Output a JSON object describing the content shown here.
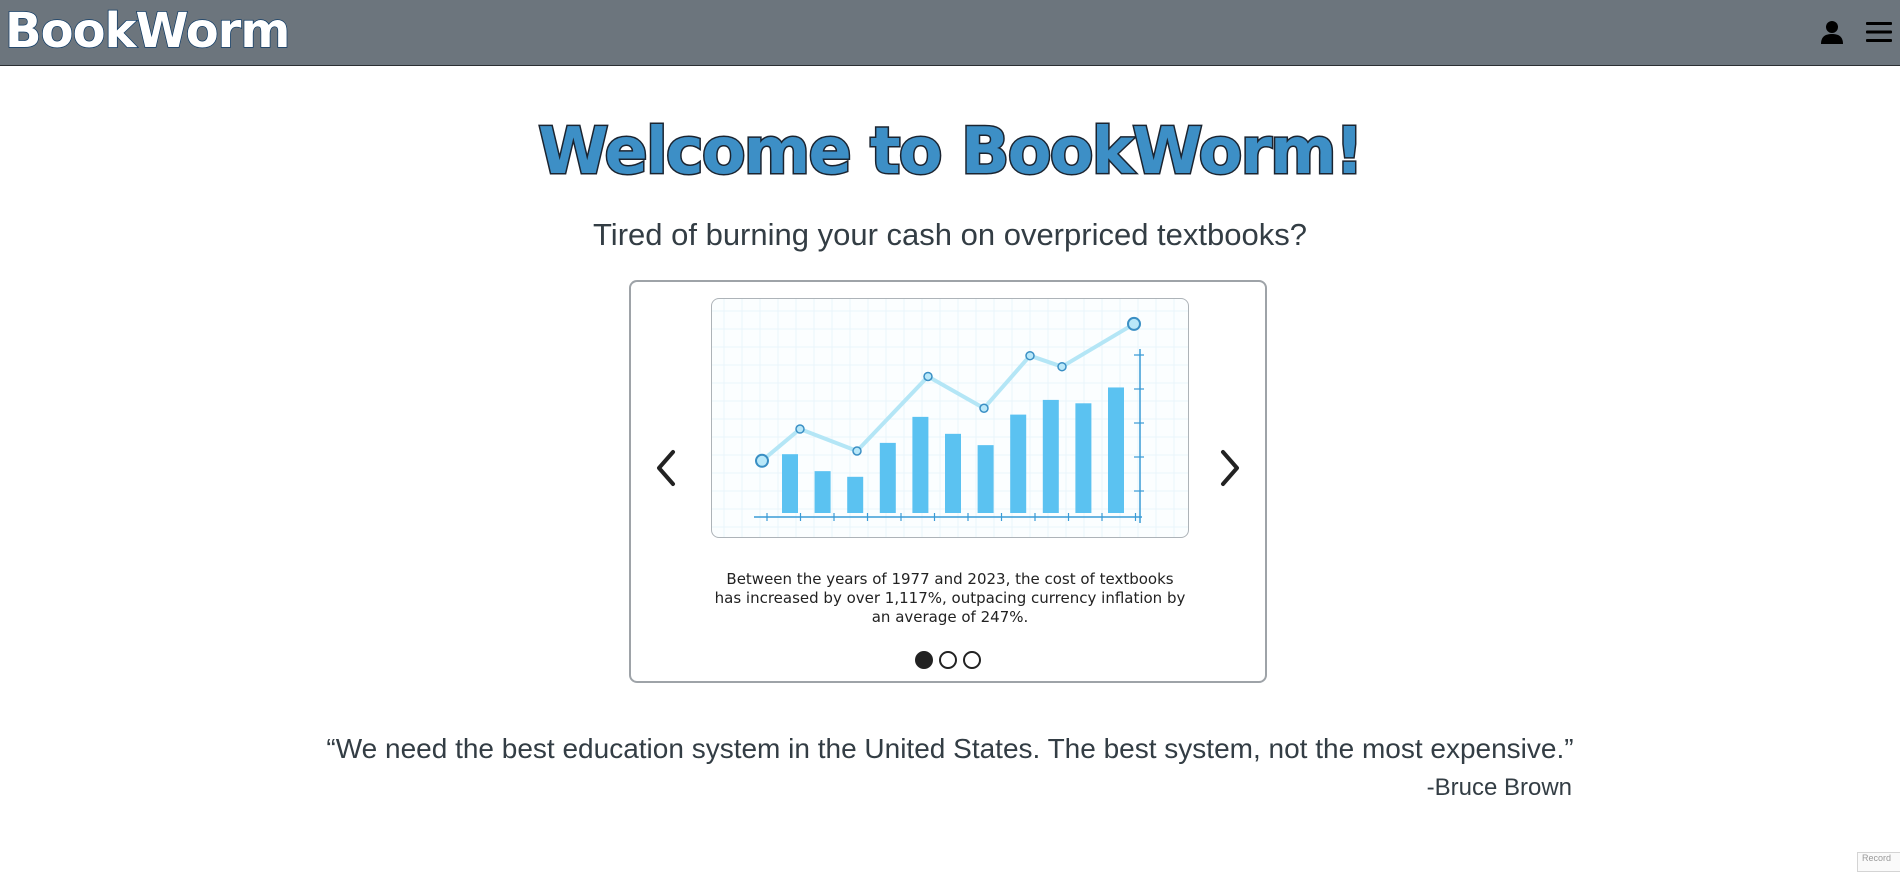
{
  "header": {
    "brand": "BookWorm",
    "icons": [
      "user-icon",
      "hamburger-menu-icon"
    ]
  },
  "hero": {
    "title": "Welcome to BookWorm!",
    "subtitle": "Tired of burning your cash on overpriced textbooks?"
  },
  "carousel": {
    "slides_count": 3,
    "active_index": 0,
    "caption": "Between the years of 1977 and 2023, the cost of textbooks has increased by over 1,117%, outpacing currency inflation by an average of 247%.",
    "prev_icon": "chevron-left-icon",
    "next_icon": "chevron-right-icon"
  },
  "quote": {
    "text": "“We need the best education system in the United States. The best system, not the most expensive.”",
    "author": "-Bruce Brown"
  },
  "colors": {
    "navbar": "#6c757d",
    "title": "#3d8fc6",
    "bars": "#5bc2f1",
    "line": "#b4e6f6",
    "axis": "#3a9bd6"
  },
  "illustration": {
    "bars": [
      0.52,
      0.37,
      0.32,
      0.62,
      0.85,
      0.7,
      0.6,
      0.87,
      1.0,
      0.97,
      1.11
    ],
    "line": [
      0.46,
      0.72,
      0.54,
      1.15,
      0.89,
      1.32,
      1.23,
      1.58
    ]
  },
  "corner_widget": {
    "label": "Record"
  }
}
